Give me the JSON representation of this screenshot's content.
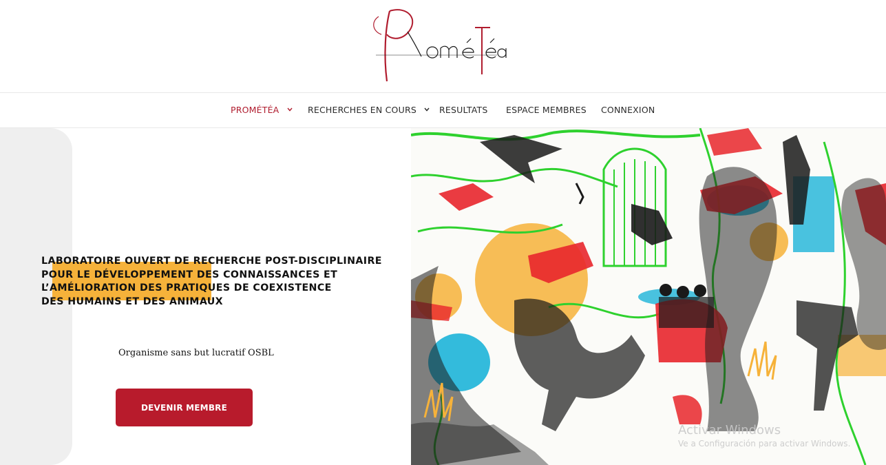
{
  "brand": {
    "logo_text": "Prométéa",
    "accent": "#b01c2e"
  },
  "nav": {
    "items": [
      {
        "label": "PROMÉTÉA",
        "active": true,
        "dropdown": true
      },
      {
        "label": "RECHERCHES EN COURS",
        "active": false,
        "dropdown": true
      },
      {
        "label": "RESULTATS",
        "active": false,
        "dropdown": false
      },
      {
        "label": "ESPACE MEMBRES",
        "active": false,
        "dropdown": false
      },
      {
        "label": "CONNEXION",
        "active": false,
        "dropdown": false
      }
    ]
  },
  "hero": {
    "headline_lines": [
      "LABORATOIRE OUVERT DE RECHERCHE POST-DISCIPLINAIRE",
      "POUR LE DÉVELOPPEMENT DES CONNAISSANCES ET",
      "L’AMÉLIORATION DES PRATIQUES DE COEXISTENCE",
      "DES HUMAINS ET DES ANIMAUX"
    ],
    "tagline": "Organisme sans but lucratif OSBL",
    "cta_label": "DEVENIR MEMBRE",
    "highlight_color": "#f6b23a",
    "button_color": "#b81b2c"
  },
  "watermark": {
    "line1": "Activar Windows",
    "line2": "Ve a Configuración para activar Windows."
  }
}
